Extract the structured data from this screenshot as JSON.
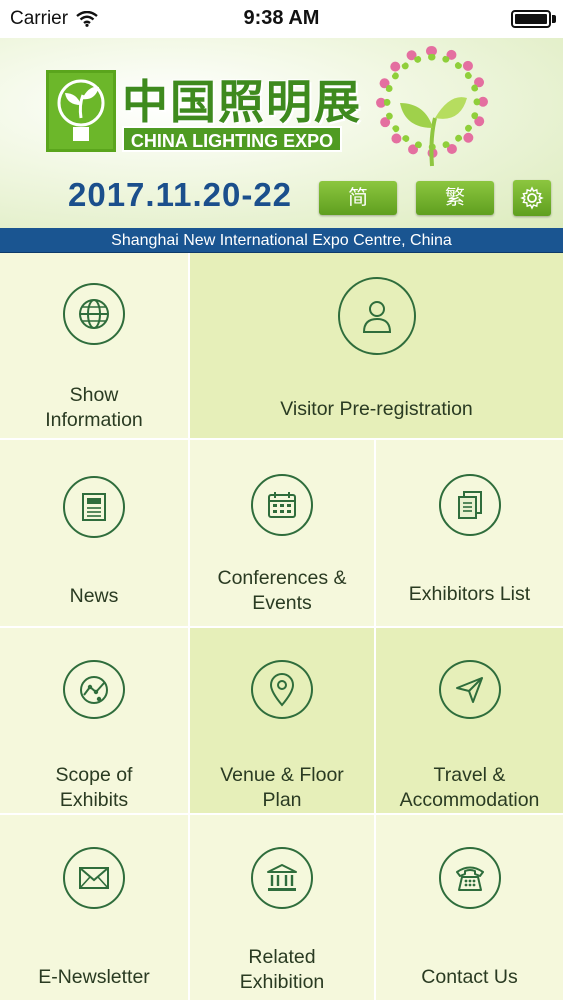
{
  "status_bar": {
    "carrier": "Carrier",
    "time": "9:38 AM"
  },
  "banner": {
    "logo_title": "中国照明展",
    "logo_subtitle": "CHINA LIGHTING EXPO",
    "dates": "2017.11.20-22",
    "btn_simplified": "简",
    "btn_traditional": "繁"
  },
  "venue": "Shanghai New International Expo Centre, China",
  "tiles": [
    {
      "label": "Show Information",
      "icon": "globe-icon"
    },
    {
      "label": "Visitor Pre-registration",
      "icon": "user-icon"
    },
    {
      "label": "News",
      "icon": "newspaper-icon"
    },
    {
      "label": "Conferences & Events",
      "icon": "calendar-icon"
    },
    {
      "label": "Exhibitors List",
      "icon": "documents-icon"
    },
    {
      "label": "Scope of Exhibits",
      "icon": "chart-icon"
    },
    {
      "label": "Venue & Floor Plan",
      "icon": "map-pin-icon"
    },
    {
      "label": "Travel & Accommodation",
      "icon": "paper-plane-icon"
    },
    {
      "label": "E-Newsletter",
      "icon": "envelope-icon"
    },
    {
      "label": "Related Exhibition",
      "icon": "building-icon"
    },
    {
      "label": "Contact Us",
      "icon": "telephone-icon"
    }
  ],
  "colors": {
    "banner_green": "#5aa51c",
    "date_blue": "#1b4f8c",
    "venue_bar": "#1a5591",
    "tile_light": "#f5f8dc",
    "tile_dark": "#e6efb9",
    "icon_stroke": "#2f6d3c"
  }
}
